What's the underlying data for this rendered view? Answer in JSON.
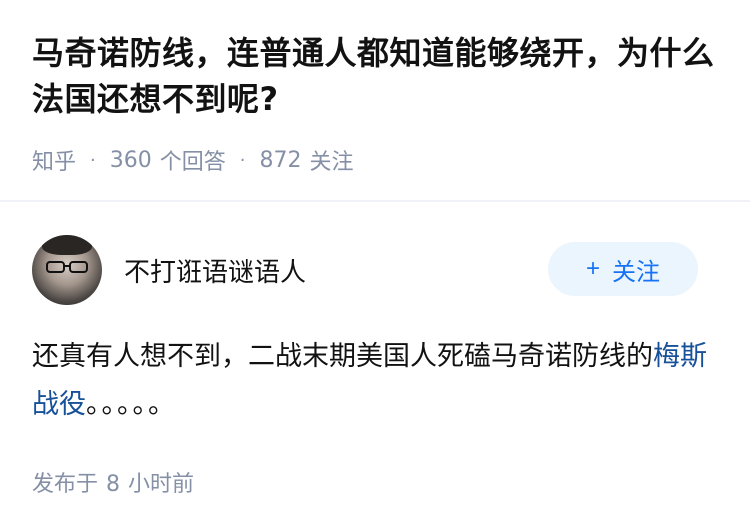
{
  "question": {
    "title": "马奇诺防线，连普通人都知道能够绕开，为什么法国还想不到呢?",
    "source": "知乎",
    "answer_count": "360",
    "answer_label": "个回答",
    "follower_count": "872",
    "follower_label": "关注"
  },
  "author": {
    "name": "不打诳语谜语人",
    "follow_label": "关注",
    "follow_icon": "plus-icon"
  },
  "answer": {
    "text_before_link": "还真有人想不到，二战末期美国人死磕马奇诺防线的",
    "link_text": "梅斯战役",
    "text_after_link": "。。。。。"
  },
  "footer": {
    "posted_prefix": "发布于",
    "posted_number": "8",
    "posted_suffix": "小时前"
  },
  "colors": {
    "link": "#175199",
    "follow_text": "#1772f6",
    "follow_bg": "#ebf5fd",
    "meta_gray": "#8590a6"
  }
}
